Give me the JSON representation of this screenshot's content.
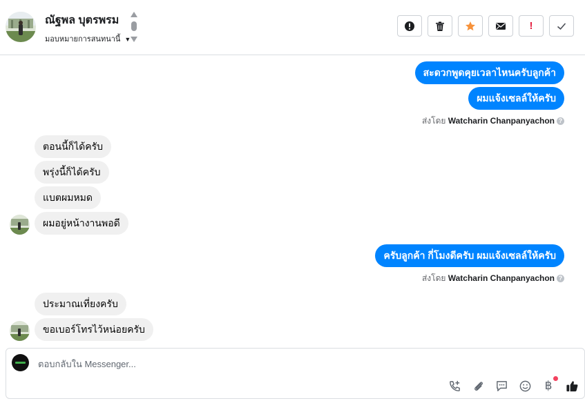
{
  "header": {
    "contact_name": "ณัฐพล บุตรพรม",
    "assign_label": "มอบหมายการสนทนานี้",
    "actions": [
      {
        "name": "mark-spam-button",
        "icon": "alert-circle-icon"
      },
      {
        "name": "delete-button",
        "icon": "trash-icon"
      },
      {
        "name": "star-button",
        "icon": "star-icon"
      },
      {
        "name": "mark-unread-button",
        "icon": "envelope-icon"
      },
      {
        "name": "flag-button",
        "icon": "exclamation-icon"
      },
      {
        "name": "mark-done-button",
        "icon": "checkmark-icon"
      }
    ]
  },
  "messages": {
    "m1": "สะดวกพูดคุยเวลาไหนครับลูกค้า",
    "m2": "ผมแจ้งเซลล์ให้ครับ",
    "sent_by_prefix_1": "ส่งโดย",
    "sent_by_name_1": "Watcharin Chanpanyachon",
    "m3": "ตอนนี้ก็ได้ครับ",
    "m4": "พรุ่งนี้ก็ได้ครับ",
    "m5": "แบตผมหมด",
    "m6": "ผมอยู่หน้างานพอดี",
    "m7": "ครับลูกค้า กี่โมงดีครับ ผมแจ้งเซลล์ให้ครับ",
    "sent_by_prefix_2": "ส่งโดย",
    "sent_by_name_2": "Watcharin Chanpanyachon",
    "m8": "ประมาณเที่ยงครับ",
    "m9": "ขอเบอร์โทรไว้หน่อยครับ"
  },
  "composer": {
    "placeholder": "ตอบกลับใน Messenger...",
    "currency_symbol": "฿"
  },
  "colors": {
    "outgoing": "#0084ff",
    "incoming": "#f0f0f0",
    "star": "#f7923b",
    "flag": "#e41e3f"
  }
}
